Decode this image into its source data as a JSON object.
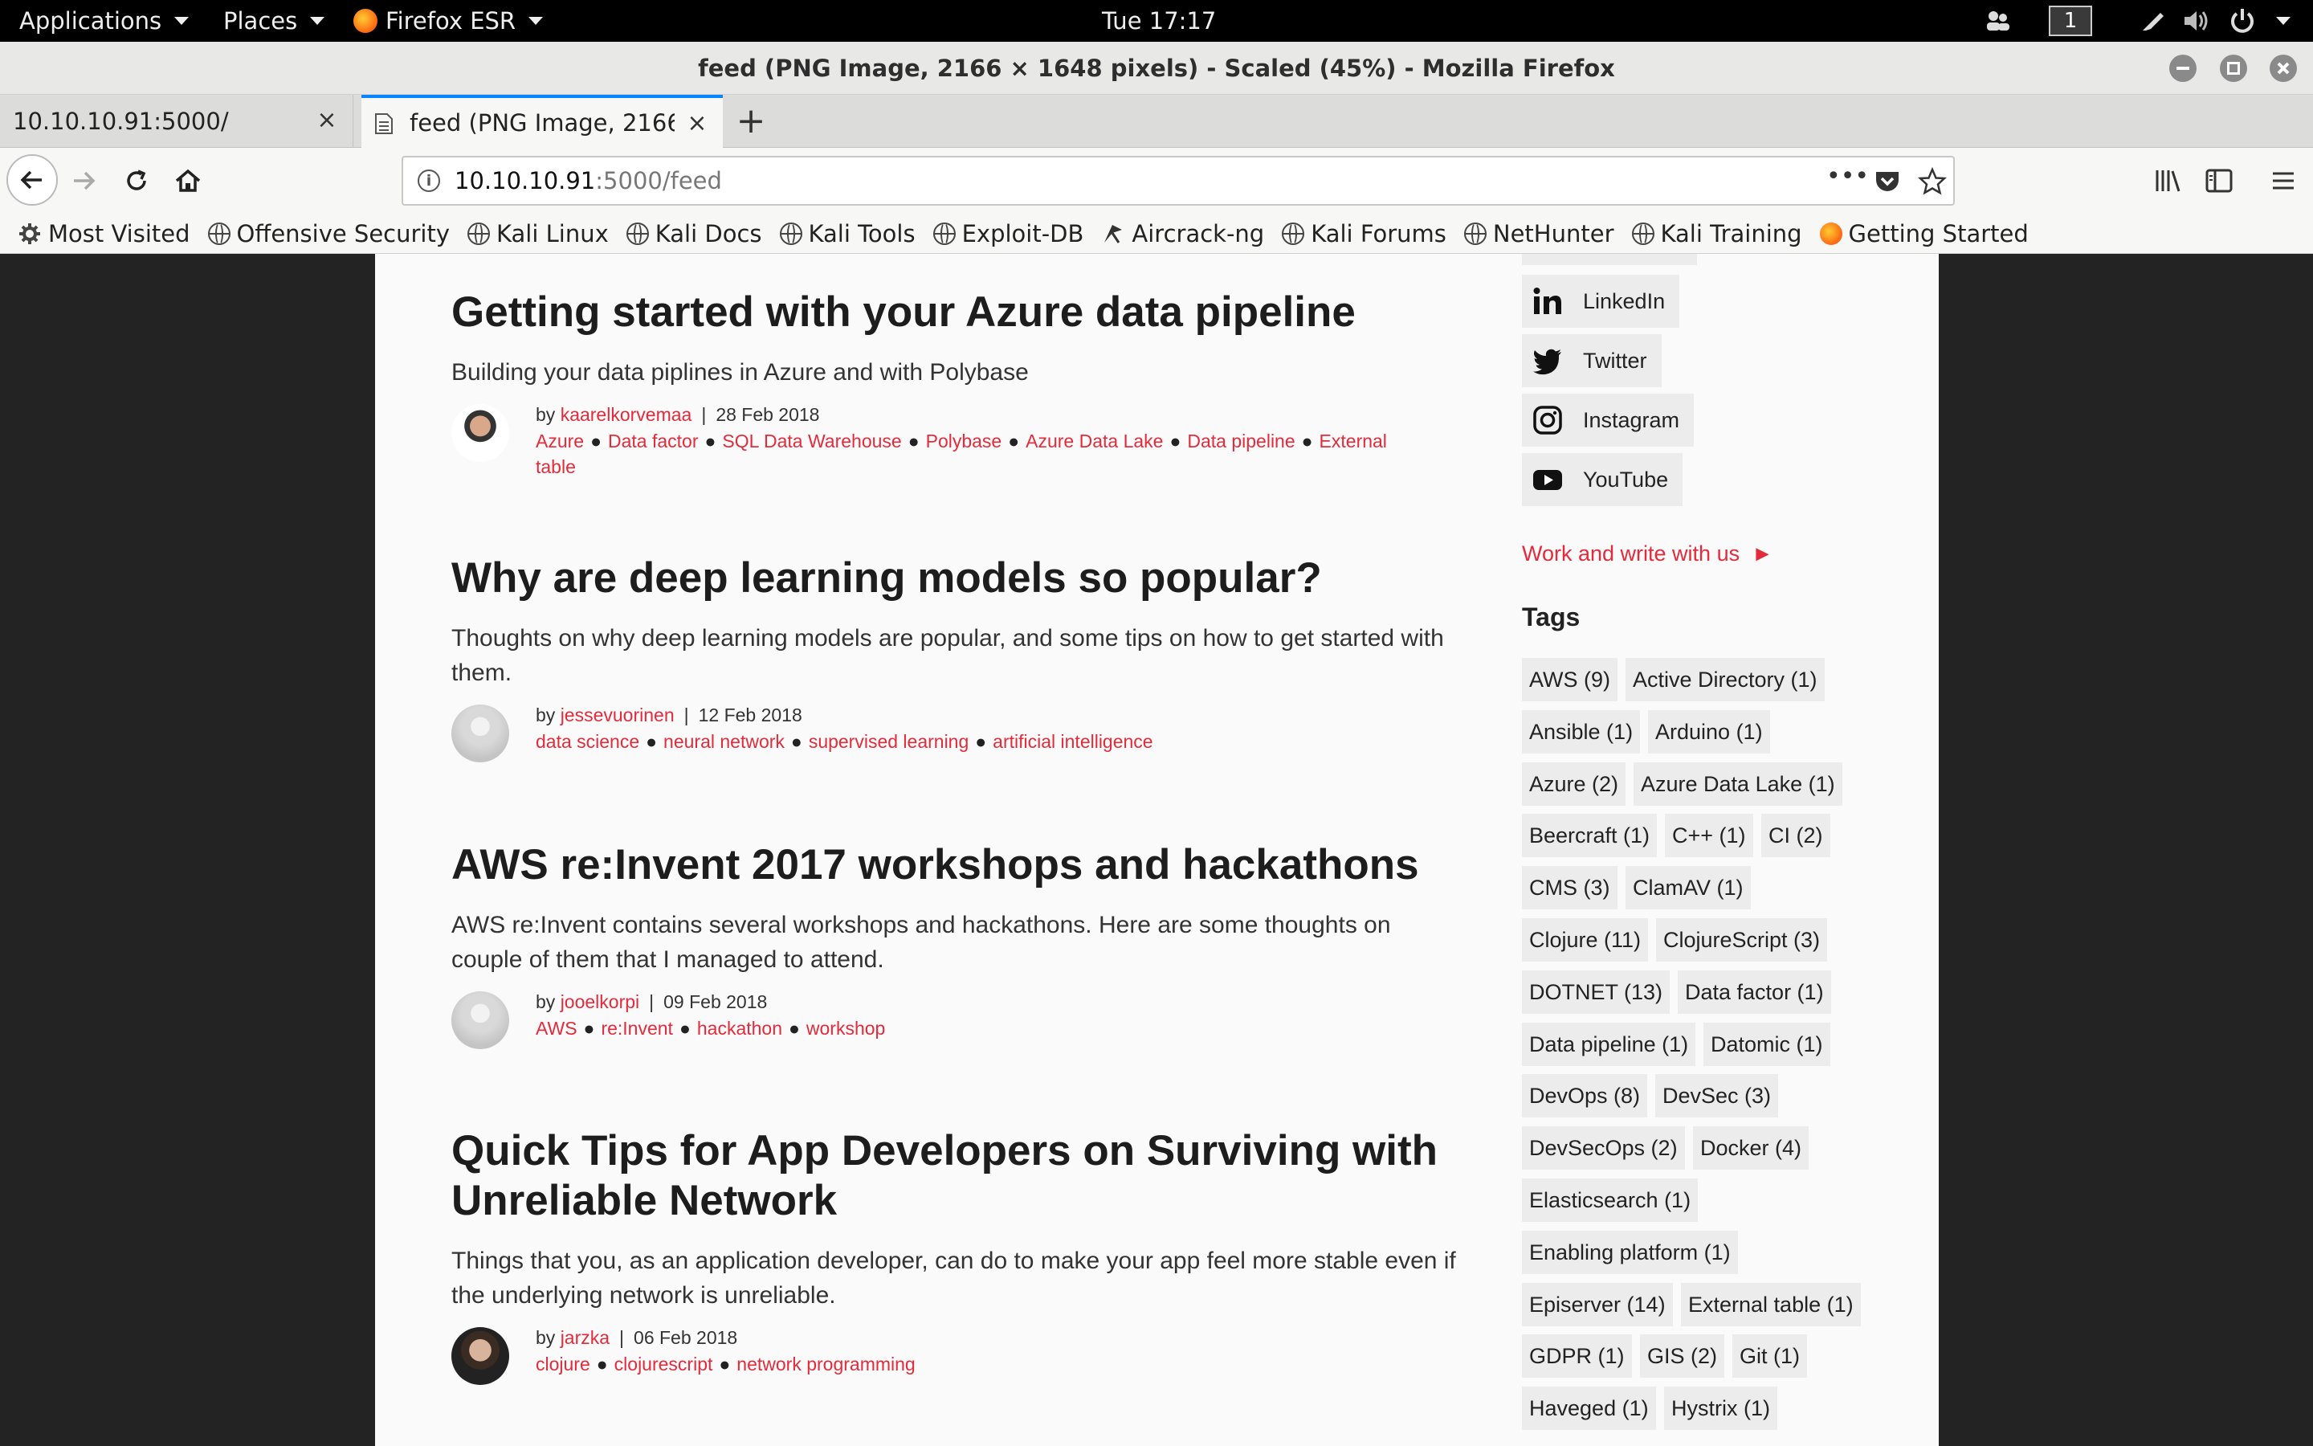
{
  "topbar": {
    "applications": "Applications",
    "places": "Places",
    "browser": "Firefox ESR",
    "clock": "Tue 17:17",
    "workspace": "1"
  },
  "window": {
    "title": "feed (PNG Image, 2166 × 1648 pixels) - Scaled (45%) - Mozilla Firefox"
  },
  "tabs": [
    {
      "label": "10.10.10.91:5000/"
    },
    {
      "label": "feed (PNG Image, 2166 ×"
    }
  ],
  "urlbar": {
    "host": "10.10.10.91",
    "path": ":5000/feed"
  },
  "bookmarks": [
    {
      "label": "Most Visited",
      "icon": "gear-icon"
    },
    {
      "label": "Offensive Security",
      "icon": "globe-icon"
    },
    {
      "label": "Kali Linux",
      "icon": "globe-icon"
    },
    {
      "label": "Kali Docs",
      "icon": "globe-icon"
    },
    {
      "label": "Kali Tools",
      "icon": "globe-icon"
    },
    {
      "label": "Exploit-DB",
      "icon": "globe-icon"
    },
    {
      "label": "Aircrack-ng",
      "icon": "aircrack-icon"
    },
    {
      "label": "Kali Forums",
      "icon": "globe-icon"
    },
    {
      "label": "NetHunter",
      "icon": "globe-icon"
    },
    {
      "label": "Kali Training",
      "icon": "globe-icon"
    },
    {
      "label": "Getting Started",
      "icon": "firefox-icon"
    }
  ],
  "posts": [
    {
      "title": "Getting started with your Azure data pipeline",
      "description": "Building your data piplines in Azure and with Polybase",
      "by": "by",
      "author": "kaarelkorvemaa",
      "date": "28 Feb 2018",
      "tags_line1": [
        "Azure",
        "Data factor",
        "SQL Data Warehouse",
        "Polybase",
        "Azure Data Lake",
        "Data pipeline",
        "External"
      ],
      "tags_line2": [
        "table"
      ]
    },
    {
      "title": "Why are deep learning models so popular?",
      "description": "Thoughts on why deep learning models are popular, and some tips on how to get started with them.",
      "by": "by",
      "author": "jessevuorinen",
      "date": "12 Feb 2018",
      "tags_line1": [
        "data science",
        "neural network",
        "supervised learning",
        "artificial intelligence"
      ],
      "tags_line2": []
    },
    {
      "title": "AWS re:Invent 2017 workshops and hackathons",
      "description": "AWS re:Invent contains several workshops and hackathons. Here are some thoughts on couple of them that I managed to attend.",
      "by": "by",
      "author": "jooelkorpi",
      "date": "09 Feb 2018",
      "tags_line1": [
        "AWS",
        "re:Invent",
        "hackathon",
        "workshop"
      ],
      "tags_line2": []
    },
    {
      "title": "Quick Tips for App Developers on Surviving with Unreliable Network",
      "description": "Things that you, as an application developer, can do to make your app feel more stable even if the underlying network is unreliable.",
      "by": "by",
      "author": "jarzka",
      "date": "06 Feb 2018",
      "tags_line1": [
        "clojure",
        "clojurescript",
        "network programming"
      ],
      "tags_line2": []
    }
  ],
  "sidebar": {
    "social": [
      {
        "label": "LinkedIn",
        "icon": "linkedin-icon"
      },
      {
        "label": "Twitter",
        "icon": "twitter-icon"
      },
      {
        "label": "Instagram",
        "icon": "instagram-icon"
      },
      {
        "label": "YouTube",
        "icon": "youtube-icon"
      }
    ],
    "work_link": "Work and write with us",
    "work_arrow": "►",
    "tags_heading": "Tags",
    "tags": [
      [
        "AWS (9)",
        "Active Directory (1)"
      ],
      [
        "Ansible (1)",
        "Arduino (1)"
      ],
      [
        "Azure (2)",
        "Azure Data Lake (1)"
      ],
      [
        "Beercraft (1)",
        "C++ (1)",
        "CI (2)"
      ],
      [
        "CMS (3)",
        "ClamAV (1)"
      ],
      [
        "Clojure (11)",
        "ClojureScript (3)"
      ],
      [
        "DOTNET (13)",
        "Data factor (1)"
      ],
      [
        "Data pipeline (1)",
        "Datomic (1)"
      ],
      [
        "DevOps (8)",
        "DevSec (3)"
      ],
      [
        "DevSecOps (2)",
        "Docker (4)"
      ],
      [
        "Elasticsearch (1)"
      ],
      [
        "Enabling platform (1)"
      ],
      [
        "Episerver (14)",
        "External table (1)"
      ],
      [
        "GDPR (1)",
        "GIS (2)",
        "Git (1)"
      ],
      [
        "Haveged (1)",
        "Hystrix (1)"
      ]
    ]
  },
  "colors": {
    "accent": "#e32b3b",
    "tab_highlight": "#0a84ff"
  }
}
